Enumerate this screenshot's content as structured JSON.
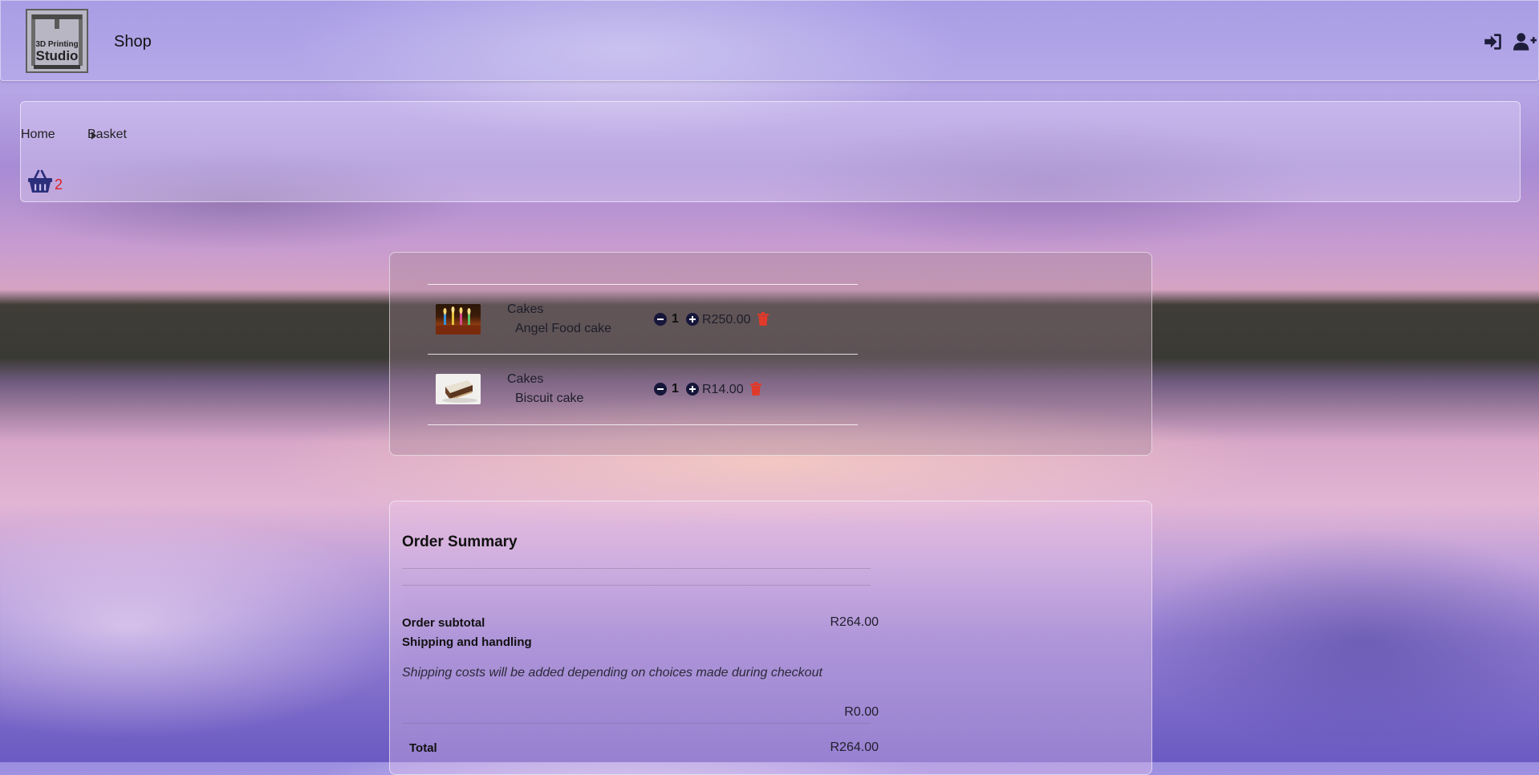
{
  "header": {
    "logo_text_line1": "3D Printing",
    "logo_text_line2": "Studio",
    "title": "Shop",
    "login_icon": "sign-in-icon",
    "register_icon": "user-plus-icon"
  },
  "breadcrumb": {
    "items": [
      "Home",
      "Basket"
    ],
    "separator_icon": "caret-right-icon"
  },
  "basket": {
    "icon": "basket-icon",
    "count": "2"
  },
  "items": [
    {
      "category": "Cakes",
      "name": "Angel Food cake",
      "quantity": "1",
      "price": "R250.00",
      "image": "birthday-candles-cake-image"
    },
    {
      "category": "Cakes",
      "name": "Biscuit cake",
      "quantity": "1",
      "price": "R14.00",
      "image": "biscuit-cake-slice-image"
    }
  ],
  "summary": {
    "title": "Order Summary",
    "subtotal_label": "Order subtotal",
    "subtotal_value": "R264.00",
    "shipping_label": "Shipping and handling",
    "shipping_note": "Shipping costs will be added depending on choices made during checkout",
    "shipping_value": "R0.00",
    "total_label": "Total",
    "total_value": "R264.00"
  },
  "colors": {
    "accent": "#2b2e7a",
    "delete": "#e03a2a",
    "badge": "#e02020"
  }
}
